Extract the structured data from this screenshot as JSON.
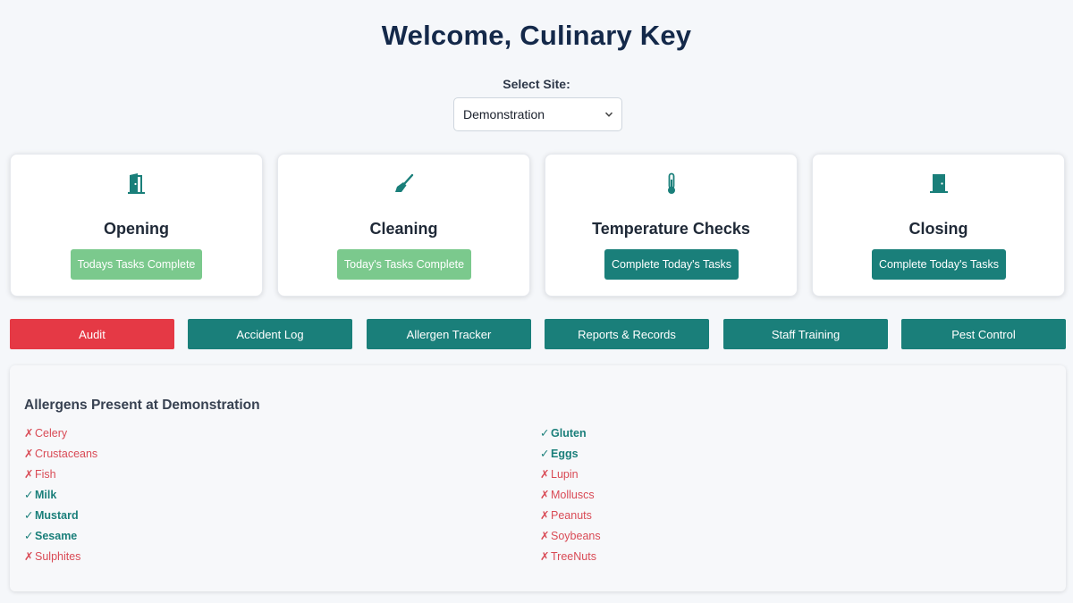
{
  "header": {
    "title": "Welcome, Culinary Key"
  },
  "site": {
    "label": "Select Site:",
    "selected": "Demonstration"
  },
  "cards": [
    {
      "icon": "door-open-icon",
      "title": "Opening",
      "button": "Todays Tasks Complete",
      "status": "complete"
    },
    {
      "icon": "broom-icon",
      "title": "Cleaning",
      "button": "Today's Tasks Complete",
      "status": "complete"
    },
    {
      "icon": "thermometer-icon",
      "title": "Temperature Checks",
      "button": "Complete Today's Tasks",
      "status": "pending"
    },
    {
      "icon": "door-closed-icon",
      "title": "Closing",
      "button": "Complete Today's Tasks",
      "status": "pending"
    }
  ],
  "nav": [
    "Audit",
    "Accident Log",
    "Allergen Tracker",
    "Reports & Records",
    "Staff Training",
    "Pest Control"
  ],
  "allergens": {
    "title": "Allergens Present at Demonstration",
    "present_mark": "✓",
    "absent_mark": "✗",
    "left": [
      {
        "name": "Celery",
        "present": false
      },
      {
        "name": "Crustaceans",
        "present": false
      },
      {
        "name": "Fish",
        "present": false
      },
      {
        "name": "Milk",
        "present": true
      },
      {
        "name": "Mustard",
        "present": true
      },
      {
        "name": "Sesame",
        "present": true
      },
      {
        "name": "Sulphites",
        "present": false
      }
    ],
    "right": [
      {
        "name": "Gluten",
        "present": true
      },
      {
        "name": "Eggs",
        "present": true
      },
      {
        "name": "Lupin",
        "present": false
      },
      {
        "name": "Molluscs",
        "present": false
      },
      {
        "name": "Peanuts",
        "present": false
      },
      {
        "name": "Soybeans",
        "present": false
      },
      {
        "name": "TreeNuts",
        "present": false
      }
    ]
  },
  "colors": {
    "accent": "#1a7f7a",
    "complete": "#7bc98d",
    "danger": "#e53945",
    "title": "#14294a"
  }
}
